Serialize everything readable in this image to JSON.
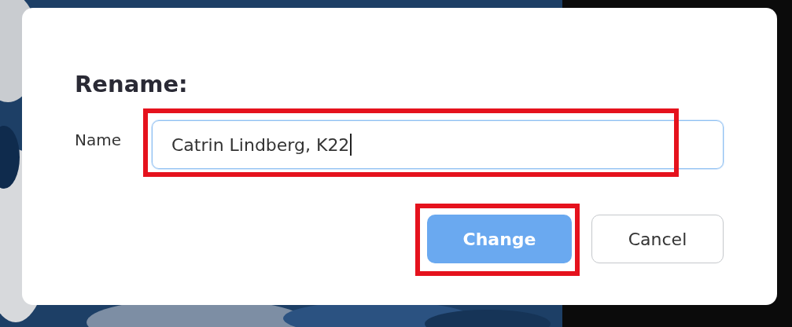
{
  "dialog": {
    "title": "Rename:",
    "field": {
      "label": "Name",
      "value": "Catrin Lindberg, K22",
      "focused": true,
      "highlighted": true
    },
    "buttons": [
      {
        "label": "Change",
        "kind": "primary",
        "highlighted": true
      },
      {
        "label": "Cancel",
        "kind": "secondary",
        "highlighted": false
      }
    ]
  }
}
